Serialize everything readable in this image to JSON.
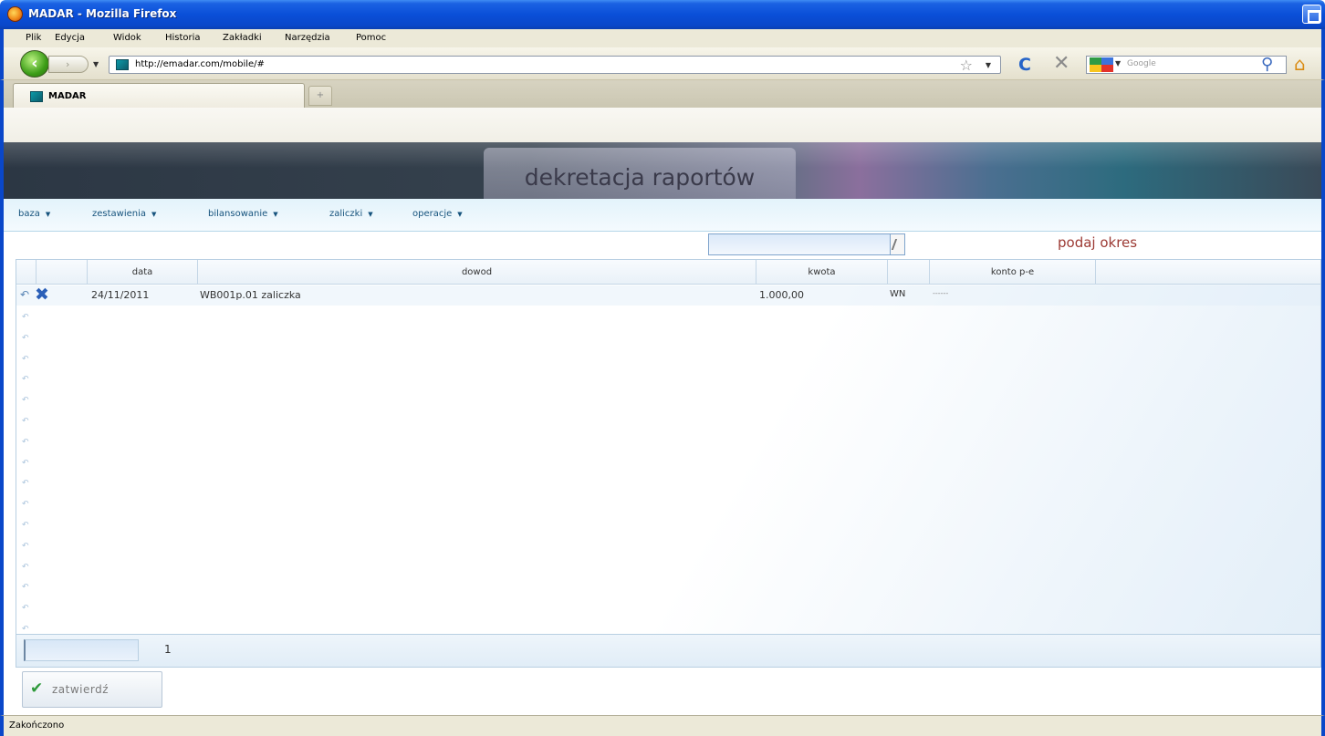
{
  "window": {
    "title": "MADAR - Mozilla Firefox"
  },
  "menubar": [
    "Plik",
    "Edycja",
    "Widok",
    "Historia",
    "Zakładki",
    "Narzędzia",
    "Pomoc"
  ],
  "nav": {
    "url": "http://emadar.com/mobile/#",
    "search_placeholder": "Google"
  },
  "tabs": [
    {
      "label": "MADAR"
    }
  ],
  "app": {
    "title": "dekretacja raportów",
    "menu": [
      "baza",
      "zestawienia",
      "bilansowanie",
      "zaliczki",
      "operacje"
    ],
    "period_label": "podaj okres",
    "table": {
      "columns": [
        "data",
        "dowod",
        "kwota",
        "",
        "konto p-e"
      ],
      "rows": [
        {
          "data": "24/11/2011",
          "dowod": "WB001p.01 zaliczka",
          "kwota": "1.000,00",
          "strona": "WN",
          "konto": "------"
        }
      ]
    },
    "pager": {
      "page": "1"
    },
    "confirm_label": "zatwierdź"
  },
  "status": "Zakończono",
  "colors": {
    "titlebar": "#0a47c9",
    "accent_text": "#9c3a34",
    "menu_text": "#16537d"
  }
}
